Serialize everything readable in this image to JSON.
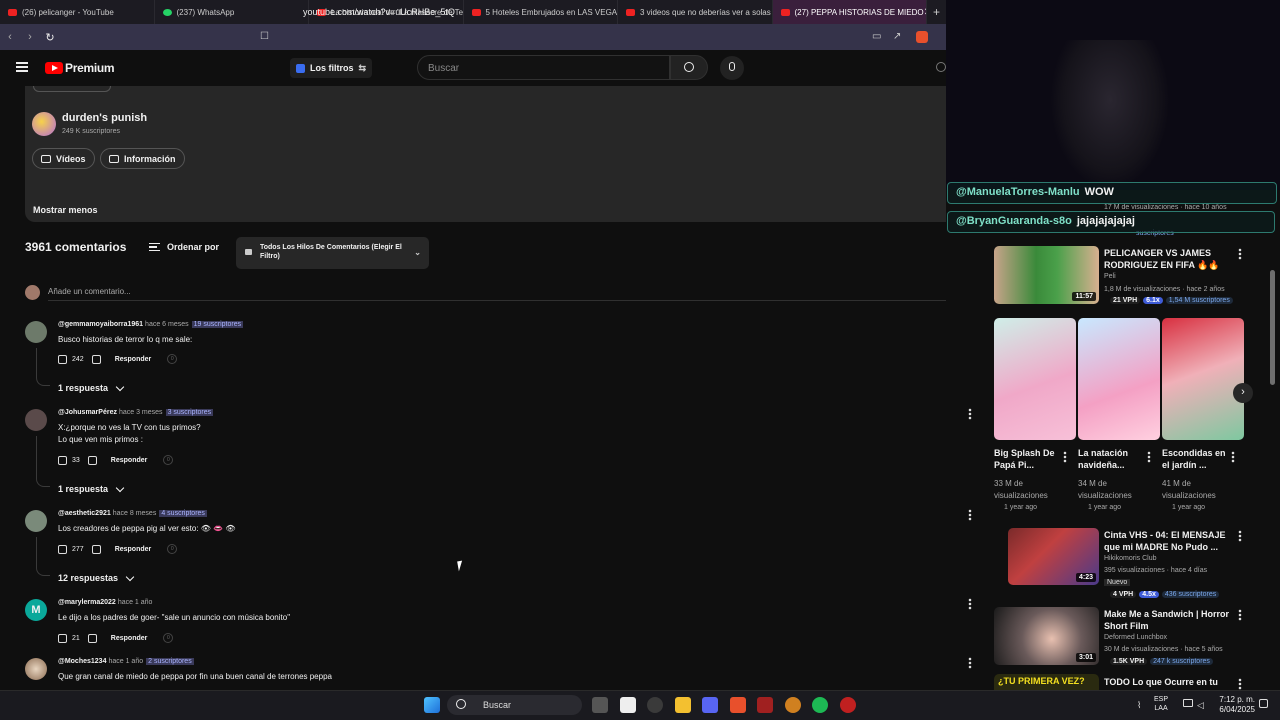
{
  "browser": {
    "tabs": [
      {
        "title": "(26) pelicanger - YouTube",
        "favicon": "youtube-icon",
        "color": "#e22"
      },
      {
        "title": "(237) WhatsApp",
        "favicon": "whatsapp-icon",
        "color": "#25d366"
      },
      {
        "title": "La historia real de \"La masacre de Te",
        "favicon": "youtube-icon",
        "color": "#e22"
      },
      {
        "title": "5 Hoteles Embrujados en LAS VEGAS",
        "favicon": "youtube-icon",
        "color": "#e22"
      },
      {
        "title": "3 videos que no deberías ver a solas",
        "favicon": "youtube-icon",
        "color": "#e22"
      },
      {
        "title": "(27) PEPPA HISTORIAS DE MIEDO",
        "favicon": "youtube-icon",
        "color": "#e22",
        "active": true
      }
    ],
    "new_tab": "+",
    "close_tab": "✕",
    "url": "youtube.com/watch?v=uUcRHBe_5tQ"
  },
  "header": {
    "brand": "Premium",
    "filters_label": "Los filtros",
    "search_placeholder": "Buscar"
  },
  "channel": {
    "name": "durden's punish",
    "subscribers": "249 K suscriptores",
    "buttons": [
      "Vídeos",
      "Información"
    ],
    "show_less": "Mostrar menos"
  },
  "comments_section": {
    "count": "3961 comentarios",
    "sort_label": "Ordenar por",
    "thread_filter": "Todos Los Hilos De Comentarios (Elegir El Filtro)",
    "add_comment_placeholder": "Añade un comentario...",
    "reply_label": "Responder",
    "comments": [
      {
        "author": "@gemmamoyaiborra1961",
        "time": "hace 6 meses",
        "subs": "19 suscriptores",
        "text": "Busco historias de terror lo q me sale:",
        "likes": "242",
        "replies": "1 respuesta"
      },
      {
        "author": "@JohusmarPérez",
        "time": "hace 3 meses",
        "subs": "3 suscriptores",
        "text": "X:¿porque no ves la TV con tus primos?",
        "text2": "Lo que ven mis primos :",
        "likes": "33",
        "replies": "1 respuesta"
      },
      {
        "author": "@aesthetic2921",
        "time": "hace 8 meses",
        "subs": "4 suscriptores",
        "text": "Los creadores de peppa pig al ver esto: 👁 👄 👁",
        "likes": "277",
        "replies": "12 respuestas"
      },
      {
        "author": "@marylerma2022",
        "time": "hace 1 año",
        "subs": "",
        "text": "Le dijo a los padres de goer- \"sale un anuncio con música bonito\"",
        "likes": "21",
        "replies": ""
      },
      {
        "author": "@Moches1234",
        "time": "hace 1 año",
        "subs": "2 suscriptores",
        "text": "Que gran canal de miedo de peppa por fin una buen canal de terrones peppa",
        "likes": "",
        "replies": ""
      }
    ]
  },
  "stream_chat": [
    {
      "user": "@ManuelaTorres-Manlu",
      "message": "WOW"
    },
    {
      "user": "@BryanGuaranda-s8o",
      "message": "jajajajajajaj"
    }
  ],
  "sidebar": {
    "partial_top": {
      "views": "17 M de visualizaciones · hace 10 años",
      "sub_fragment": "suscriptores"
    },
    "video1": {
      "title": "PELICANGER VS JAMES RODRIGUEZ EN FIFA 🔥🔥",
      "channel": "Peli",
      "meta": "1,8 M de visualizaciones · hace 2 años",
      "duration": "11:57",
      "vph": "21 VPH",
      "mult": "6.1x",
      "subs": "1,54 M suscriptores"
    },
    "shorts": [
      {
        "title": "Big Splash De Papá Pi...",
        "views": "33 M de visualizaciones",
        "ago": "1 year ago"
      },
      {
        "title": "La natación navideña...",
        "views": "34 M de visualizaciones",
        "ago": "1 year ago"
      },
      {
        "title": "Escondidas en el jardín ...",
        "views": "41 M de visualizaciones",
        "ago": "1 year ago"
      }
    ],
    "video2": {
      "title": "Cinta VHS - 04: El MENSAJE que mi MADRE No Pudo ...",
      "channel": "Hikikomoris Club",
      "meta": "395 visualizaciones · hace 4 días",
      "badge": "Nuevo",
      "duration": "4:23",
      "vph": "4 VPH",
      "mult": "4.5x",
      "subs": "436 suscriptores"
    },
    "video3": {
      "title": "Make Me a Sandwich | Horror Short Film",
      "channel": "Deformed Lunchbox",
      "meta": "30 M de visualizaciones · hace 5 años",
      "duration": "3:01",
      "vph": "1.5K VPH",
      "subs": "247 k suscriptores"
    },
    "video4": {
      "title": "TODO Lo que Ocurre en tu",
      "thumb_text": "¿TU PRIMERA VEZ?"
    }
  },
  "taskbar": {
    "search": "Buscar",
    "lang_line1": "ESP",
    "lang_line2": "LAA",
    "time": "7:12 p. m.",
    "date": "6/04/2025"
  }
}
